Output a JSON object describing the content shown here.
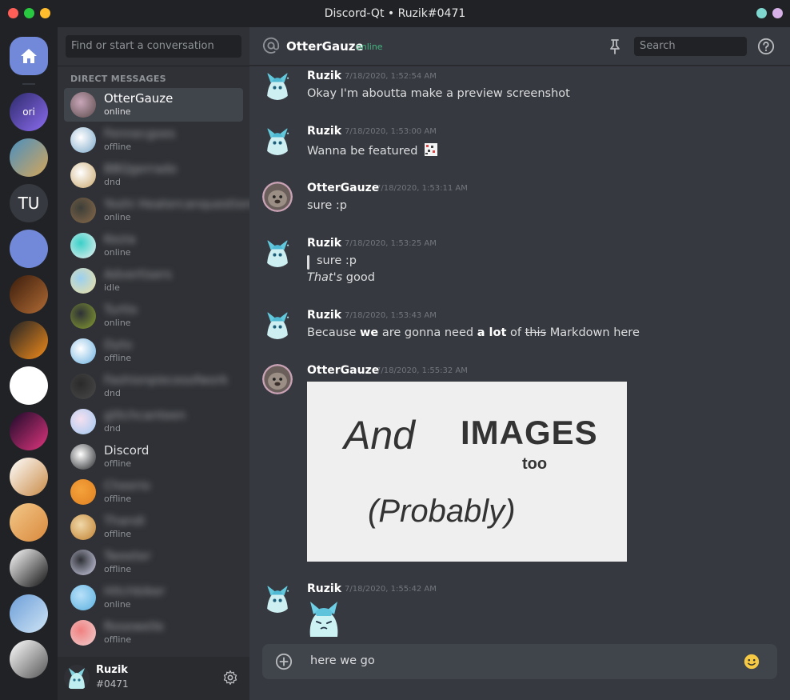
{
  "window": {
    "title": "Discord-Qt • Ruzik#0471",
    "dots_left": [
      "#ff5f57",
      "#28c940",
      "#ffbd2e"
    ],
    "dots_right": [
      "#7fd8d0",
      "#d6b0e6"
    ]
  },
  "guilds": {
    "home_icon": "home-icon",
    "items": [
      {
        "name": "guild-ori",
        "label": "ori",
        "colors": [
          "#2d2a6b",
          "#8c6cf0"
        ]
      },
      {
        "name": "guild-coast",
        "label": "",
        "colors": [
          "#4a8fbf",
          "#d4a65a"
        ]
      },
      {
        "name": "guild-tu",
        "label": "TU",
        "colors": [
          "#36393f",
          "#36393f"
        ]
      },
      {
        "name": "guild-linux",
        "label": "",
        "colors": [
          "#7289da",
          "#7289da"
        ]
      },
      {
        "name": "guild-coffee",
        "label": "",
        "colors": [
          "#3a1c0c",
          "#b06b34"
        ]
      },
      {
        "name": "guild-bird",
        "label": "",
        "colors": [
          "#202225",
          "#f08a1a"
        ]
      },
      {
        "name": "guild-xkcd",
        "label": "",
        "colors": [
          "#ffffff",
          "#ffffff"
        ]
      },
      {
        "name": "guild-rocket",
        "label": "",
        "colors": [
          "#1a0a2a",
          "#e0357d"
        ]
      },
      {
        "name": "guild-eevee",
        "label": "",
        "colors": [
          "#ffffff",
          "#c98a46"
        ]
      },
      {
        "name": "guild-cat",
        "label": "",
        "colors": [
          "#f3c88a",
          "#d9893c"
        ]
      },
      {
        "name": "guild-black",
        "label": "",
        "colors": [
          "#ffffff",
          "#111111"
        ]
      },
      {
        "name": "guild-ghost",
        "label": "",
        "colors": [
          "#6c9ed8",
          "#cfe4f5"
        ]
      },
      {
        "name": "guild-zebra",
        "label": "",
        "colors": [
          "#ffffff",
          "#555555"
        ]
      }
    ]
  },
  "dms": {
    "search_placeholder": "Find or start a conversation",
    "heading": "DIRECT MESSAGES",
    "items": [
      {
        "name": "OtterGauze",
        "status": "online",
        "blur": false,
        "active": true,
        "colors": [
          "#c8a6b8",
          "#5a4a4a"
        ]
      },
      {
        "name": "Fennecgoes",
        "status": "offline",
        "blur": true,
        "colors": [
          "#ffffff",
          "#7aa7c8"
        ]
      },
      {
        "name": "BBQgerrado",
        "status": "dnd",
        "blur": true,
        "colors": [
          "#ffffff",
          "#c9a66b"
        ]
      },
      {
        "name": "Yoshi Heatercanquestions",
        "status": "online",
        "blur": true,
        "colors": [
          "#3c3e38",
          "#8a6a4a"
        ]
      },
      {
        "name": "Kezia",
        "status": "online",
        "blur": true,
        "colors": [
          "#3ad0c8",
          "#f0f0f0"
        ]
      },
      {
        "name": "Advertisers",
        "status": "idle",
        "blur": true,
        "colors": [
          "#9ad0f0",
          "#f0e0a0"
        ]
      },
      {
        "name": "Turtlo",
        "status": "online",
        "blur": true,
        "colors": [
          "#2f3136",
          "#88a030"
        ]
      },
      {
        "name": "Dyto",
        "status": "offline",
        "blur": true,
        "colors": [
          "#ffffff",
          "#6ab0e0"
        ]
      },
      {
        "name": "Fashionpiecesofwork",
        "status": "dnd",
        "blur": true,
        "colors": [
          "#2a2a2a",
          "#4a4a4a"
        ]
      },
      {
        "name": "glitchcanteen",
        "status": "dnd",
        "blur": true,
        "colors": [
          "#f5e0f0",
          "#a0c8f0"
        ]
      },
      {
        "name": "Discord",
        "status": "offline",
        "blur": false,
        "colors": [
          "#ffffff",
          "#202225"
        ]
      },
      {
        "name": "Cheerio",
        "status": "offline",
        "blur": true,
        "colors": [
          "#f4a23c",
          "#e08020"
        ]
      },
      {
        "name": "Thandi",
        "status": "offline",
        "blur": true,
        "colors": [
          "#f0d8a8",
          "#c08030"
        ]
      },
      {
        "name": "Tweeter",
        "status": "offline",
        "blur": true,
        "colors": [
          "#2f3136",
          "#d0d0e8"
        ]
      },
      {
        "name": "Hitchbiker",
        "status": "online",
        "blur": true,
        "colors": [
          "#b8e0f8",
          "#5ab0e0"
        ]
      },
      {
        "name": "Rosewelle",
        "status": "offline",
        "blur": true,
        "colors": [
          "#f08080",
          "#f0d0d0"
        ]
      }
    ]
  },
  "user": {
    "name": "Ruzik",
    "tag": "#0471"
  },
  "chat": {
    "channel_name": "OtterGauze",
    "channel_status": "online",
    "search_placeholder": "Search",
    "messages": [
      {
        "author": "Ruzik",
        "time": "7/18/2020, 1:52:54 AM",
        "text": "Okay I'm aboutta make a preview screenshot"
      },
      {
        "author": "Ruzik",
        "time": "7/18/2020, 1:53:00 AM",
        "text": "Wanna be featured"
      },
      {
        "author": "OtterGauze",
        "time": "7/18/2020, 1:53:11 AM",
        "text": "sure :p"
      },
      {
        "author": "Ruzik",
        "time": "7/18/2020, 1:53:25 AM",
        "quote": "sure :p",
        "text_em": "That's",
        "text_rest": " good"
      },
      {
        "author": "Ruzik",
        "time": "7/18/2020, 1:53:43 AM",
        "t1": "Because ",
        "t2": "we",
        "t3": " are gonna need ",
        "t4": "a lot",
        "t5": " of ",
        "t6": "this",
        "t7": " Markdown here"
      },
      {
        "author": "OtterGauze",
        "time": "7/18/2020, 1:55:32 AM",
        "image": {
          "and": "And",
          "images": "IMAGES",
          "too": "too",
          "probably": "(Probably)"
        }
      },
      {
        "author": "Ruzik",
        "time": "7/18/2020, 1:55:42 AM"
      }
    ],
    "composer_text": "here we go"
  }
}
